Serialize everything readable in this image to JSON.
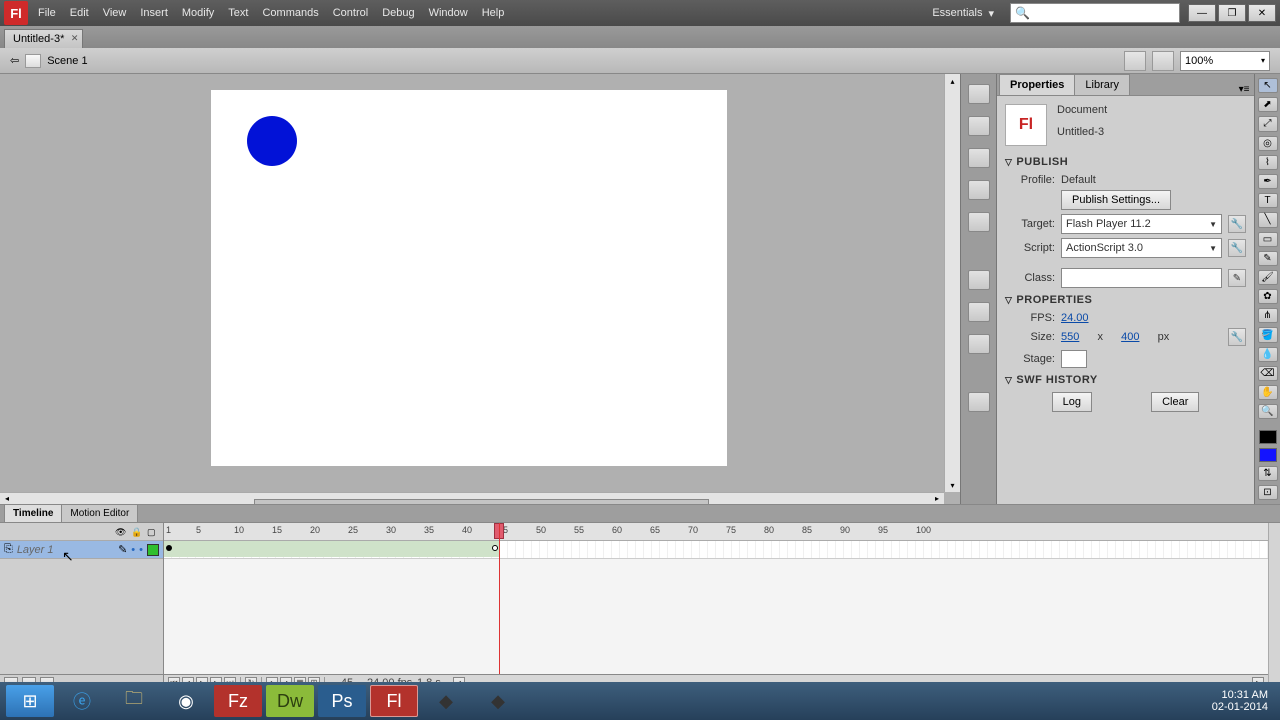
{
  "menu": {
    "file": "File",
    "edit": "Edit",
    "view": "View",
    "insert": "Insert",
    "modify": "Modify",
    "text": "Text",
    "commands": "Commands",
    "control": "Control",
    "debug": "Debug",
    "window": "Window",
    "help": "Help"
  },
  "workspace": {
    "label": "Essentials"
  },
  "doc": {
    "tab": "Untitled-3*",
    "scene": "Scene 1",
    "zoom": "100%"
  },
  "properties": {
    "tabProperties": "Properties",
    "tabLibrary": "Library",
    "type": "Document",
    "name": "Untitled-3",
    "publish": {
      "hdr": "PUBLISH",
      "profileLabel": "Profile:",
      "profile": "Default",
      "settingsBtn": "Publish Settings...",
      "targetLabel": "Target:",
      "target": "Flash Player 11.2",
      "scriptLabel": "Script:",
      "script": "ActionScript 3.0",
      "classLabel": "Class:",
      "classVal": ""
    },
    "props": {
      "hdr": "PROPERTIES",
      "fpsLabel": "FPS:",
      "fps": "24.00",
      "sizeLabel": "Size:",
      "w": "550",
      "x": "x",
      "h": "400",
      "px": "px",
      "stageLabel": "Stage:"
    },
    "swf": {
      "hdr": "SWF HISTORY",
      "log": "Log",
      "clear": "Clear"
    }
  },
  "timeline": {
    "tabTimeline": "Timeline",
    "tabMotion": "Motion Editor",
    "layerName": "Layer 1",
    "layerColor": "#2fbf2f",
    "ticks": [
      "1",
      "5",
      "10",
      "15",
      "20",
      "25",
      "30",
      "35",
      "40",
      "45",
      "50",
      "55",
      "60",
      "65",
      "70",
      "75",
      "80",
      "85",
      "90",
      "95",
      "100"
    ],
    "status": {
      "frame": "45",
      "fps": "24.00 fps",
      "time": "1.8 s"
    }
  },
  "clock": {
    "time": "10:31 AM",
    "date": "02-01-2014"
  }
}
